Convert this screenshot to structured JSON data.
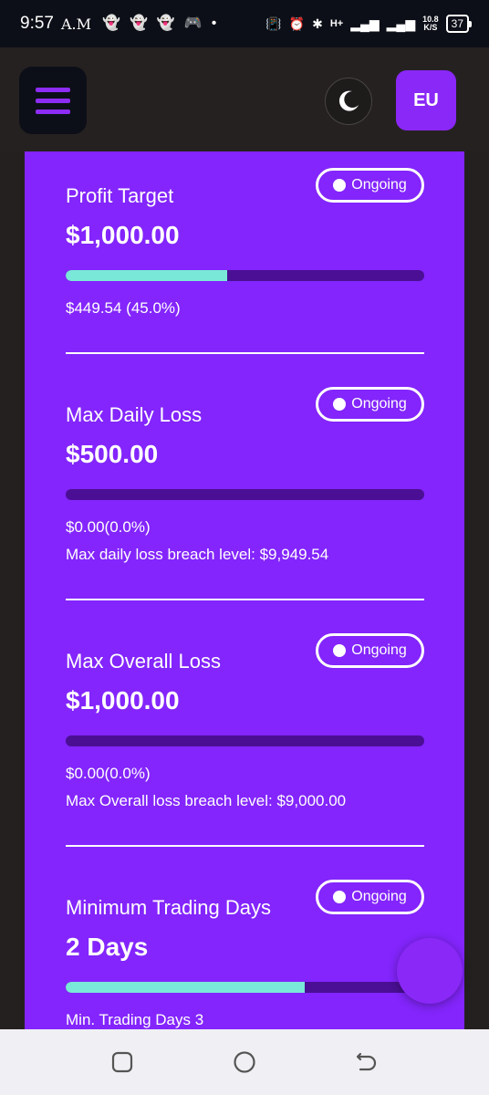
{
  "status_bar": {
    "time": "9:57",
    "ampm": "A.M",
    "net_speed_value": "10.8",
    "net_speed_unit": "K/S",
    "network_type": "H+",
    "battery_level": "37"
  },
  "header": {
    "avatar_initials": "EU"
  },
  "sections": [
    {
      "title": "Profit Target",
      "value": "$1,000.00",
      "status": "Ongoing",
      "progress_percent": 45.0,
      "line1": "$449.54 (45.0%)",
      "line2": ""
    },
    {
      "title": "Max Daily Loss",
      "value": "$500.00",
      "status": "Ongoing",
      "progress_percent": 0.0,
      "line1": "$0.00(0.0%)",
      "line2": "Max daily loss breach level: $9,949.54"
    },
    {
      "title": "Max Overall Loss",
      "value": "$1,000.00",
      "status": "Ongoing",
      "progress_percent": 0.0,
      "line1": "$0.00(0.0%)",
      "line2": "Max Overall loss breach level: $9,000.00"
    },
    {
      "title": "Minimum Trading Days",
      "value": "2 Days",
      "status": "Ongoing",
      "progress_percent": 66.7,
      "line1": "Min. Trading Days 3",
      "line2": ""
    }
  ],
  "colors": {
    "card_bg": "#8325fc",
    "accent": "#8a28f7",
    "progress_fill": "#7ae8d8",
    "progress_track": "#4a0f94",
    "app_bg": "#252020"
  }
}
